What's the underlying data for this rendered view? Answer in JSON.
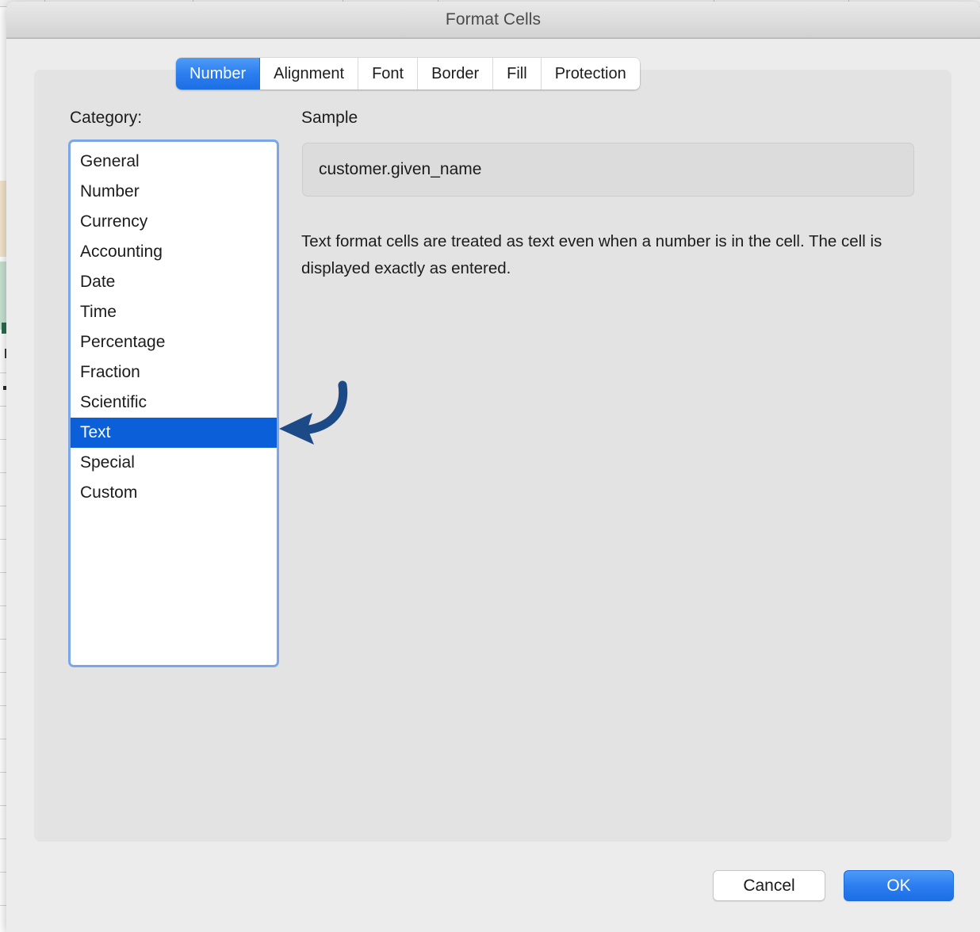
{
  "window": {
    "title": "Format Cells"
  },
  "tabs": [
    {
      "label": "Number",
      "selected": true
    },
    {
      "label": "Alignment",
      "selected": false
    },
    {
      "label": "Font",
      "selected": false
    },
    {
      "label": "Border",
      "selected": false
    },
    {
      "label": "Fill",
      "selected": false
    },
    {
      "label": "Protection",
      "selected": false
    }
  ],
  "category": {
    "label": "Category:",
    "selected": "Text",
    "items": [
      "General",
      "Number",
      "Currency",
      "Accounting",
      "Date",
      "Time",
      "Percentage",
      "Fraction",
      "Scientific",
      "Text",
      "Special",
      "Custom"
    ]
  },
  "sample": {
    "label": "Sample",
    "value": "customer.given_name"
  },
  "description": {
    "text": "Text format cells are treated as text even when a number is in the cell.  The cell is displayed exactly as entered."
  },
  "annotation": {
    "icon": "curved-arrow-left-icon",
    "color": "#1b4a86",
    "points_to": "Text"
  },
  "footer": {
    "cancel_label": "Cancel",
    "ok_label": "OK"
  },
  "colors": {
    "accent_blue": "#2b7def",
    "selection_blue": "#0b5fd8",
    "focus_ring": "#7ba7e8",
    "dialog_bg": "#ececec",
    "panel_bg": "#e3e3e3",
    "sample_bg": "#dcdcdc"
  }
}
